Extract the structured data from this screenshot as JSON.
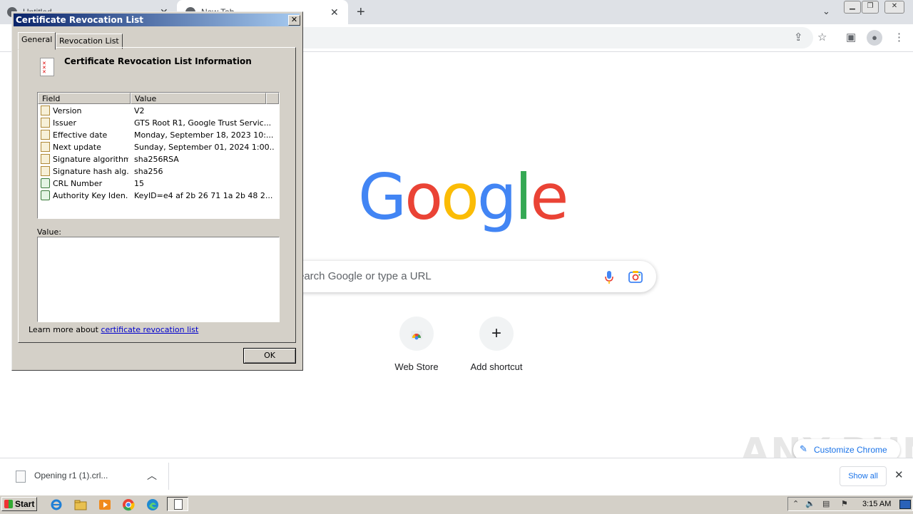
{
  "browser": {
    "tabs": [
      {
        "title": "Untitled"
      },
      {
        "title": "New Tab"
      }
    ]
  },
  "ntp": {
    "logo_letters": [
      {
        "ch": "G",
        "color": "#4285F4"
      },
      {
        "ch": "o",
        "color": "#EA4335"
      },
      {
        "ch": "o",
        "color": "#FBBC05"
      },
      {
        "ch": "g",
        "color": "#4285F4"
      },
      {
        "ch": "l",
        "color": "#34A853"
      },
      {
        "ch": "e",
        "color": "#EA4335"
      }
    ],
    "search_placeholder": "earch Google or type a URL",
    "shortcuts": [
      {
        "label": "Web Store",
        "icon": "chrome-web-store-icon"
      },
      {
        "label": "Add shortcut",
        "icon": "plus-icon",
        "glyph": "+"
      }
    ],
    "customize_label": "Customize Chrome"
  },
  "download_shelf": {
    "item_label": "Opening r1 (1).crl...",
    "show_all": "Show all"
  },
  "watermark": "ANY.RUN",
  "dialog": {
    "title": "Certificate Revocation List",
    "close_glyph": "✕",
    "tabs": [
      {
        "label": "General"
      },
      {
        "label": "Revocation List"
      }
    ],
    "info_title": "Certificate Revocation List Information",
    "columns": {
      "field": "Field",
      "value": "Value"
    },
    "rows": [
      {
        "field": "Version",
        "value": "V2",
        "icon": "document-field-icon"
      },
      {
        "field": "Issuer",
        "value": "GTS Root R1, Google Trust Servic...",
        "icon": "document-field-icon"
      },
      {
        "field": "Effective date",
        "value": "Monday, September 18, 2023 10:...",
        "icon": "document-field-icon"
      },
      {
        "field": "Next update",
        "value": "Sunday, September 01, 2024 1:00...",
        "icon": "document-field-icon"
      },
      {
        "field": "Signature algorithm",
        "value": "sha256RSA",
        "icon": "document-field-icon"
      },
      {
        "field": "Signature hash alg...",
        "value": "sha256",
        "icon": "document-field-icon"
      },
      {
        "field": "CRL Number",
        "value": "15",
        "icon": "extension-field-icon"
      },
      {
        "field": "Authority Key Iden...",
        "value": "KeyID=e4 af 2b 26 71 1a 2b 48 2...",
        "icon": "extension-field-icon"
      }
    ],
    "value_label": "Value:",
    "learn_prefix": "Learn more about ",
    "learn_link": "certificate revocation list",
    "ok_label": "OK"
  },
  "taskbar": {
    "start_label": "Start",
    "clock": "3:15 AM"
  }
}
